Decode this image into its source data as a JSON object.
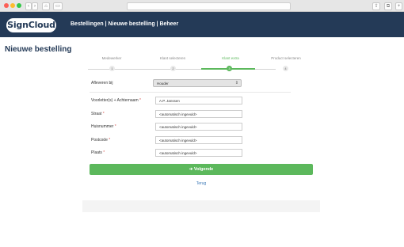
{
  "app": {
    "logo": "SignCloud",
    "nav": "Bestellingen | Nieuwe bestelling | Beheer"
  },
  "page": {
    "title": "Nieuwe bestelling"
  },
  "wizard": {
    "steps": [
      {
        "number": "1",
        "label": "Medewerker"
      },
      {
        "number": "2",
        "label": "Klant selecteren"
      },
      {
        "number": "3",
        "label": "Klant extra"
      },
      {
        "number": "4",
        "label": "Product selecteren"
      }
    ],
    "active_step": 3
  },
  "form": {
    "delivery": {
      "label": "Afleveren bij",
      "value": "Houder"
    },
    "fields": [
      {
        "label": "Voorletter(s) + Achternaam",
        "required_mark": "*",
        "value": "A.P. Janssen"
      },
      {
        "label": "Straat",
        "required_mark": "*",
        "value": "<automatisch ingevuld>"
      },
      {
        "label": "Huisnummer",
        "required_mark": "*",
        "value": "<automatisch ingevuld>"
      },
      {
        "label": "Postcode",
        "required_mark": "*",
        "value": "<automatisch ingevuld>"
      },
      {
        "label": "Plaats",
        "required_mark": "*",
        "value": "<automatisch ingevuld>"
      }
    ],
    "next_button": "Volgende",
    "next_icon": "arrow-circle-icon",
    "back_link": "Terug"
  },
  "colors": {
    "header": "#243a57",
    "accent": "#5cb85c",
    "link": "#3b79b6"
  }
}
